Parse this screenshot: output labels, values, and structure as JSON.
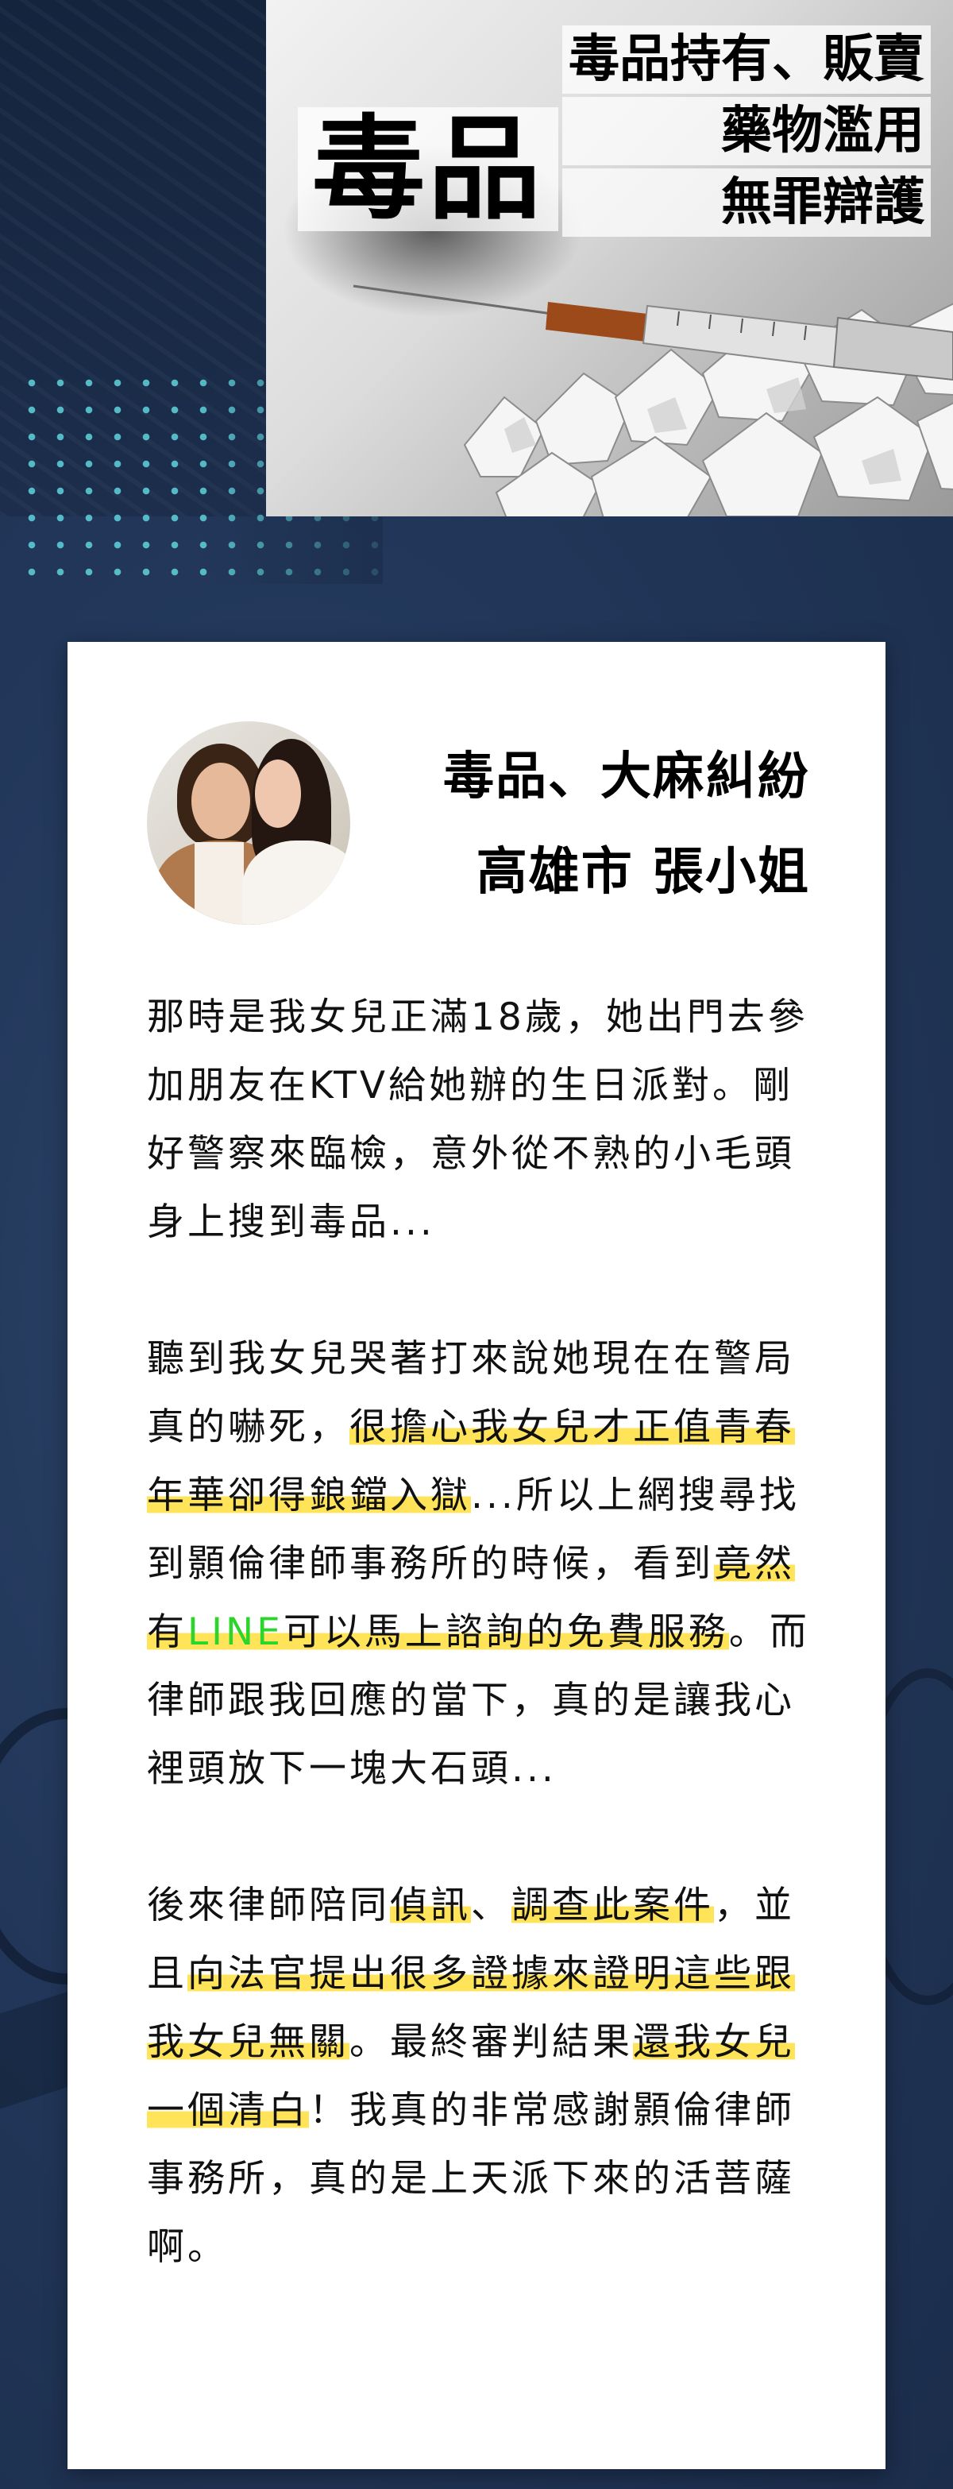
{
  "banner": {
    "badge": "毒品",
    "lines": [
      "毒品持有、販賣",
      "藥物濫用",
      "無罪辯護"
    ]
  },
  "testimonial": {
    "title_line1": "毒品、大麻糾紛",
    "title_line2": "高雄市  張小姐",
    "paragraphs": [
      [
        {
          "text": "那時是我女兒正滿18歲，她出門去參加朋友在KTV給她辦的生日派對。剛好警察來臨檢，意外從不熟的小毛頭身上搜到毒品...",
          "style": "plain"
        }
      ],
      [
        {
          "text": "聽到我女兒哭著打來說她現在在警局真的嚇死，",
          "style": "plain"
        },
        {
          "text": "很擔心我女兒才正值青春年華卻得鋃鐺入獄",
          "style": "highlight"
        },
        {
          "text": "...所以上網搜尋找到顥倫律師事務所的時候，看到",
          "style": "plain"
        },
        {
          "text": "竟然有",
          "style": "highlight"
        },
        {
          "text": "LINE",
          "style": "highlight-brand"
        },
        {
          "text": "可以馬上諮詢的免費服務",
          "style": "highlight"
        },
        {
          "text": "。而律師跟我回應的當下，真的是讓我心裡頭放下一塊大石頭...",
          "style": "plain"
        }
      ],
      [
        {
          "text": "後來律師陪同",
          "style": "plain"
        },
        {
          "text": "偵訊",
          "style": "highlight"
        },
        {
          "text": "、",
          "style": "plain"
        },
        {
          "text": "調查此案件",
          "style": "highlight"
        },
        {
          "text": "，並且",
          "style": "plain"
        },
        {
          "text": "向法官提出很多證據來證明這些跟我女兒無關",
          "style": "highlight"
        },
        {
          "text": "。最終審判結果",
          "style": "plain"
        },
        {
          "text": "還我女兒一個清白",
          "style": "highlight"
        },
        {
          "text": "！我真的非常感謝顥倫律師事務所，真的是上天派下來的活菩薩啊。",
          "style": "plain"
        }
      ]
    ]
  },
  "colors": {
    "background": "#1f3354",
    "highlight": "#ffe45a",
    "line_brand": "#2bd52b",
    "dots": "#5fd3dc"
  }
}
